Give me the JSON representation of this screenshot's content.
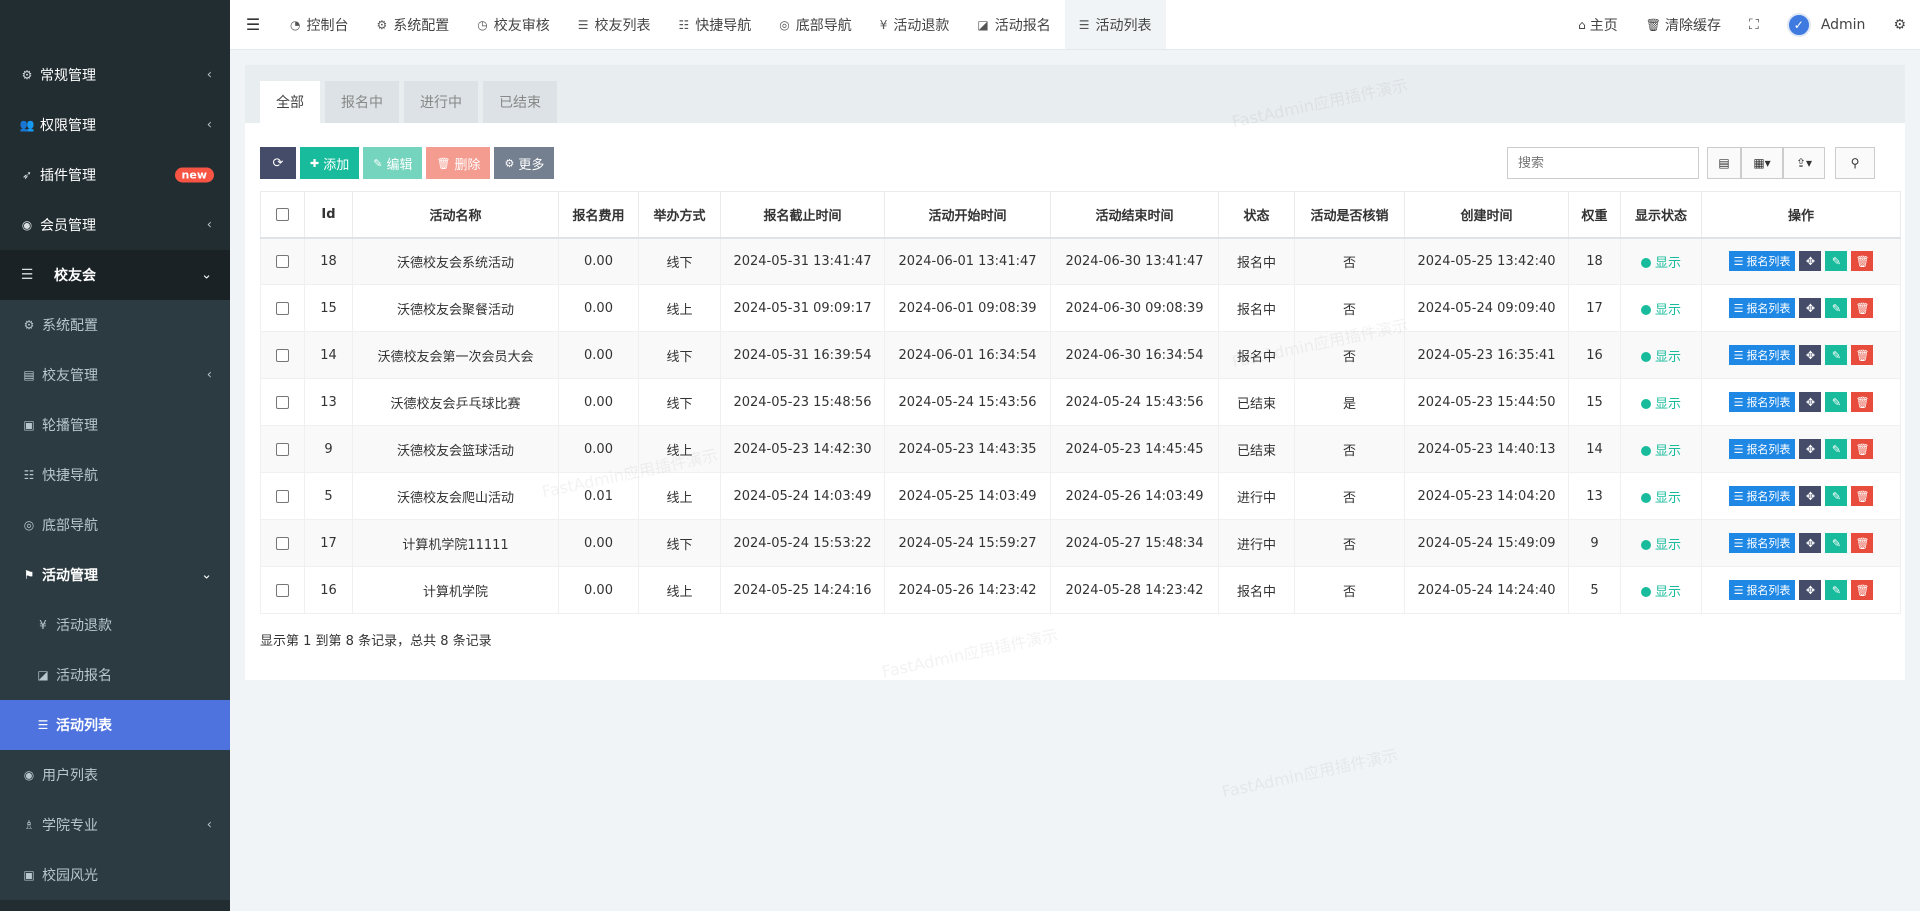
{
  "sidebar": {
    "items": [
      {
        "label": "常规管理",
        "icon": "cogs-icon",
        "arrow": "‹"
      },
      {
        "label": "权限管理",
        "icon": "users-icon",
        "arrow": "‹"
      },
      {
        "label": "插件管理",
        "icon": "rocket-icon",
        "badge": "new"
      },
      {
        "label": "会员管理",
        "icon": "user-circle-icon",
        "arrow": "‹"
      },
      {
        "label": "校友会",
        "icon": "list-icon",
        "arrow": "⌄"
      }
    ],
    "sub": [
      {
        "label": "系统配置",
        "icon": "gear-icon"
      },
      {
        "label": "校友管理",
        "icon": "id-card-icon",
        "arrow": "‹"
      },
      {
        "label": "轮播管理",
        "icon": "image-icon"
      },
      {
        "label": "快捷导航",
        "icon": "list-ul-icon"
      },
      {
        "label": "底部导航",
        "icon": "chrome-icon"
      }
    ],
    "activity_group": {
      "label": "活动管理",
      "icon": "flag-icon",
      "arrow": "⌄"
    },
    "activity_sub": [
      {
        "label": "活动退款",
        "icon": "yen-icon"
      },
      {
        "label": "活动报名",
        "icon": "edit-icon"
      },
      {
        "label": "活动列表",
        "icon": "list-icon"
      }
    ],
    "bottom": [
      {
        "label": "用户列表",
        "icon": "user-circle-icon"
      },
      {
        "label": "学院专业",
        "icon": "graduation-icon",
        "arrow": "‹"
      },
      {
        "label": "校园风光",
        "icon": "image-icon"
      }
    ]
  },
  "topbar": {
    "tabs": [
      {
        "label": "控制台",
        "icon": "dashboard-icon"
      },
      {
        "label": "系统配置",
        "icon": "gear-icon"
      },
      {
        "label": "校友审核",
        "icon": "clock-icon"
      },
      {
        "label": "校友列表",
        "icon": "list-icon"
      },
      {
        "label": "快捷导航",
        "icon": "list-ul-icon"
      },
      {
        "label": "底部导航",
        "icon": "chrome-icon"
      },
      {
        "label": "活动退款",
        "icon": "yen-icon"
      },
      {
        "label": "活动报名",
        "icon": "edit-icon"
      },
      {
        "label": "活动列表",
        "icon": "list-icon"
      }
    ],
    "home": "主页",
    "clear_cache": "清除缓存",
    "user": "Admin"
  },
  "panel": {
    "tabs": [
      "全部",
      "报名中",
      "进行中",
      "已结束"
    ],
    "toolbar": {
      "add": "添加",
      "edit": "编辑",
      "delete": "删除",
      "more": "更多"
    },
    "search_placeholder": "搜索"
  },
  "table": {
    "headers": [
      "Id",
      "活动名称",
      "报名费用",
      "举办方式",
      "报名截止时间",
      "活动开始时间",
      "活动结束时间",
      "状态",
      "活动是否核销",
      "创建时间",
      "权重",
      "显示状态",
      "操作"
    ],
    "rows": [
      {
        "id": "18",
        "name": "沃德校友会系统活动",
        "fee": "0.00",
        "mode": "线下",
        "deadline": "2024-05-31 13:41:47",
        "start": "2024-06-01 13:41:47",
        "end": "2024-06-30 13:41:47",
        "status": "报名中",
        "verified": "否",
        "created": "2024-05-25 13:42:40",
        "weight": "18",
        "show": "显示"
      },
      {
        "id": "15",
        "name": "沃德校友会聚餐活动",
        "fee": "0.00",
        "mode": "线上",
        "deadline": "2024-05-31 09:09:17",
        "start": "2024-06-01 09:08:39",
        "end": "2024-06-30 09:08:39",
        "status": "报名中",
        "verified": "否",
        "created": "2024-05-24 09:09:40",
        "weight": "17",
        "show": "显示"
      },
      {
        "id": "14",
        "name": "沃德校友会第一次会员大会",
        "fee": "0.00",
        "mode": "线下",
        "deadline": "2024-05-31 16:39:54",
        "start": "2024-06-01 16:34:54",
        "end": "2024-06-30 16:34:54",
        "status": "报名中",
        "verified": "否",
        "created": "2024-05-23 16:35:41",
        "weight": "16",
        "show": "显示"
      },
      {
        "id": "13",
        "name": "沃德校友会乒乓球比赛",
        "fee": "0.00",
        "mode": "线下",
        "deadline": "2024-05-23 15:48:56",
        "start": "2024-05-24 15:43:56",
        "end": "2024-05-24 15:43:56",
        "status": "已结束",
        "verified": "是",
        "created": "2024-05-23 15:44:50",
        "weight": "15",
        "show": "显示"
      },
      {
        "id": "9",
        "name": "沃德校友会篮球活动",
        "fee": "0.00",
        "mode": "线上",
        "deadline": "2024-05-23 14:42:30",
        "start": "2024-05-23 14:43:35",
        "end": "2024-05-23 14:45:45",
        "status": "已结束",
        "verified": "否",
        "created": "2024-05-23 14:40:13",
        "weight": "14",
        "show": "显示"
      },
      {
        "id": "5",
        "name": "沃德校友会爬山活动",
        "fee": "0.01",
        "mode": "线上",
        "deadline": "2024-05-24 14:03:49",
        "start": "2024-05-25 14:03:49",
        "end": "2024-05-26 14:03:49",
        "status": "进行中",
        "verified": "否",
        "created": "2024-05-23 14:04:20",
        "weight": "13",
        "show": "显示"
      },
      {
        "id": "17",
        "name": "计算机学院11111",
        "fee": "0.00",
        "mode": "线下",
        "deadline": "2024-05-24 15:53:22",
        "start": "2024-05-24 15:59:27",
        "end": "2024-05-27 15:48:34",
        "status": "进行中",
        "verified": "否",
        "created": "2024-05-24 15:49:09",
        "weight": "9",
        "show": "显示"
      },
      {
        "id": "16",
        "name": "计算机学院",
        "fee": "0.00",
        "mode": "线上",
        "deadline": "2024-05-25 14:24:16",
        "start": "2024-05-26 14:23:42",
        "end": "2024-05-28 14:23:42",
        "status": "报名中",
        "verified": "否",
        "created": "2024-05-24 14:24:40",
        "weight": "5",
        "show": "显示"
      }
    ],
    "op_label": "报名列表"
  },
  "footer": "显示第 1 到第 8 条记录，总共 8 条记录",
  "watermark": "FastAdmin应用插件演示",
  "colors": {
    "accent": "#18bc9c",
    "danger": "#e74c3c",
    "sidebar": "#222d32",
    "active": "#4e73df"
  }
}
